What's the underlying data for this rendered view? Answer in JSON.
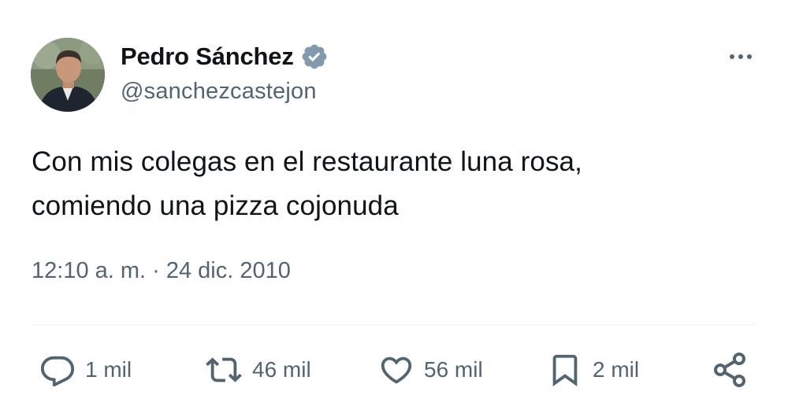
{
  "author": {
    "name": "Pedro Sánchez",
    "handle": "@sanchezcastejon",
    "verified": true
  },
  "tweet": {
    "text_line1": "Con mis colegas en el restaurante luna rosa,",
    "text_line2": "comiendo una pizza cojonuda",
    "timestamp": "12:10 a. m. · 24 dic. 2010"
  },
  "actions": {
    "reply_count": "1 mil",
    "repost_count": "46 mil",
    "like_count": "56 mil",
    "bookmark_count": "2 mil"
  },
  "icons": {
    "more": "more-icon",
    "verified": "verified-badge-icon",
    "reply": "reply-icon",
    "repost": "repost-icon",
    "like": "heart-icon",
    "bookmark": "bookmark-icon",
    "share": "share-icon"
  },
  "colors": {
    "text": "#0f1419",
    "secondary": "#536471",
    "verified_badge": "#829aab",
    "divider": "#eff3f4"
  }
}
